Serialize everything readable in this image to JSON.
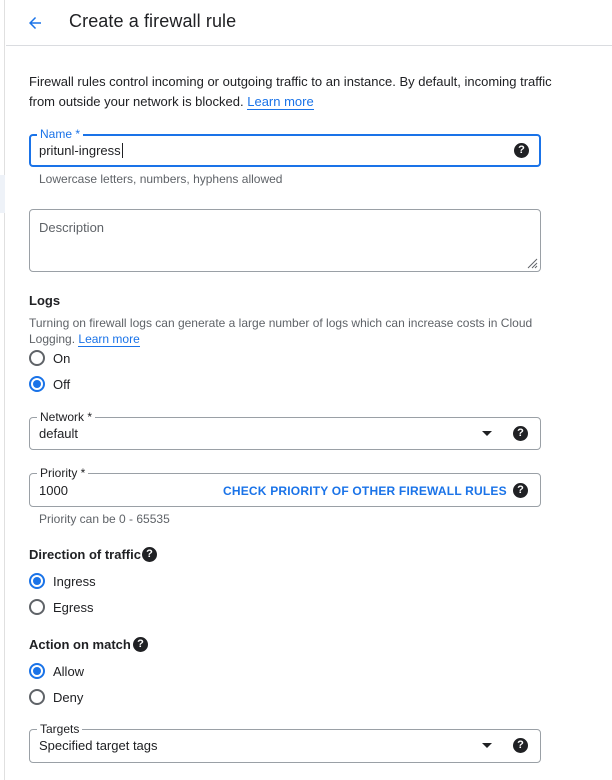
{
  "header": {
    "title": "Create a firewall rule"
  },
  "intro": {
    "text": "Firewall rules control incoming or outgoing traffic to an instance. By default, incoming traffic from outside your network is blocked.",
    "learn_more": "Learn more"
  },
  "name_field": {
    "label": "Name *",
    "value": "pritunl-ingress",
    "hint": "Lowercase letters, numbers, hyphens allowed"
  },
  "description_field": {
    "placeholder": "Description"
  },
  "logs": {
    "title": "Logs",
    "text": "Turning on firewall logs can generate a large number of logs which can increase costs in Cloud Logging.",
    "learn_more": "Learn more",
    "options": [
      {
        "label": "On",
        "checked": false
      },
      {
        "label": "Off",
        "checked": true
      }
    ]
  },
  "network_field": {
    "label": "Network *",
    "value": "default"
  },
  "priority_field": {
    "label": "Priority *",
    "value": "1000",
    "action": "CHECK PRIORITY OF OTHER FIREWALL RULES",
    "hint": "Priority can be 0 - 65535"
  },
  "direction": {
    "title": "Direction of traffic",
    "options": [
      {
        "label": "Ingress",
        "checked": true
      },
      {
        "label": "Egress",
        "checked": false
      }
    ]
  },
  "action_on_match": {
    "title": "Action on match",
    "options": [
      {
        "label": "Allow",
        "checked": true
      },
      {
        "label": "Deny",
        "checked": false
      }
    ]
  },
  "targets_field": {
    "label": "Targets",
    "value": "Specified target tags"
  },
  "colors": {
    "accent": "#1a73e8",
    "text": "#202124",
    "secondary_text": "#5f6368",
    "border": "#9aa0a6"
  },
  "icons": {
    "back": "arrow-back-icon",
    "help": "help-circle-icon",
    "dropdown": "dropdown-arrow-icon",
    "resize": "resize-handle-icon"
  }
}
